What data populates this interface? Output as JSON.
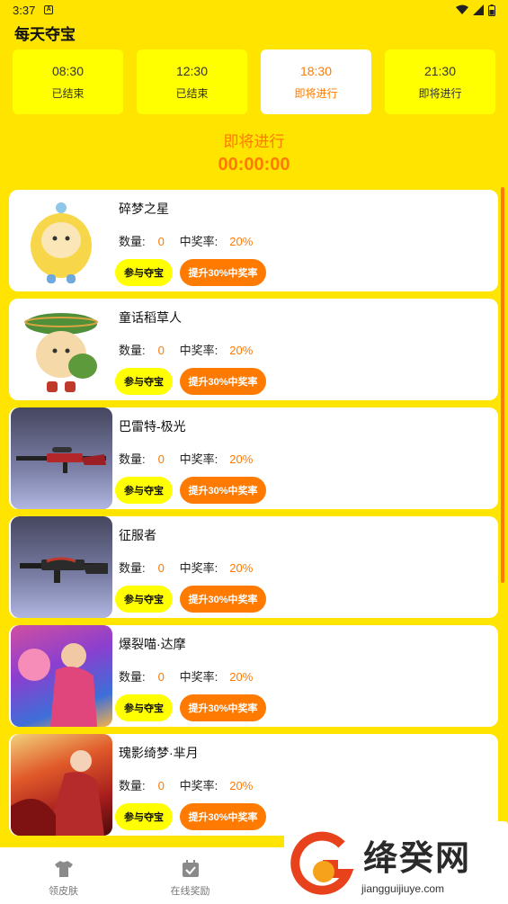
{
  "status_bar": {
    "time": "3:37",
    "notification_glyph": "A"
  },
  "app": {
    "title": "每天夺宝"
  },
  "tabs": [
    {
      "time": "08:30",
      "status": "已结束",
      "active": false
    },
    {
      "time": "12:30",
      "status": "已结束",
      "active": false
    },
    {
      "time": "18:30",
      "status": "即将进行",
      "active": true
    },
    {
      "time": "21:30",
      "status": "即将进行",
      "active": false
    }
  ],
  "countdown": {
    "label": "即将进行",
    "timer": "00:00:00"
  },
  "labels": {
    "quantity": "数量:",
    "win_rate": "中奖率:",
    "join_button": "参与夺宝",
    "boost_button": "提升30%中奖率"
  },
  "items": [
    {
      "name": "碎梦之星",
      "quantity": "0",
      "win_rate": "20%",
      "image": "yellow-mascot"
    },
    {
      "name": "童话稻草人",
      "quantity": "0",
      "win_rate": "20%",
      "image": "scarecrow-mascot"
    },
    {
      "name": "巴雷特-极光",
      "quantity": "0",
      "win_rate": "20%",
      "image": "sniper-rifle"
    },
    {
      "name": "征服者",
      "quantity": "0",
      "win_rate": "20%",
      "image": "assault-rifle"
    },
    {
      "name": "爆裂喵·达摩",
      "quantity": "0",
      "win_rate": "20%",
      "image": "hero-art"
    },
    {
      "name": "瑰影绮梦·芈月",
      "quantity": "0",
      "win_rate": "20%",
      "image": "hero-art"
    }
  ],
  "bottom_nav": [
    {
      "label": "领皮肤",
      "icon": "shirt-icon"
    },
    {
      "label": "在线奖励",
      "icon": "calendar-check-icon"
    }
  ],
  "watermark": {
    "text": "绛癸网",
    "url": "jiangguijiuye.com"
  },
  "colors": {
    "background": "#FFE400",
    "accent": "#FF7A00",
    "button_yellow": "#FFFF00",
    "card": "#FFFFFF"
  }
}
